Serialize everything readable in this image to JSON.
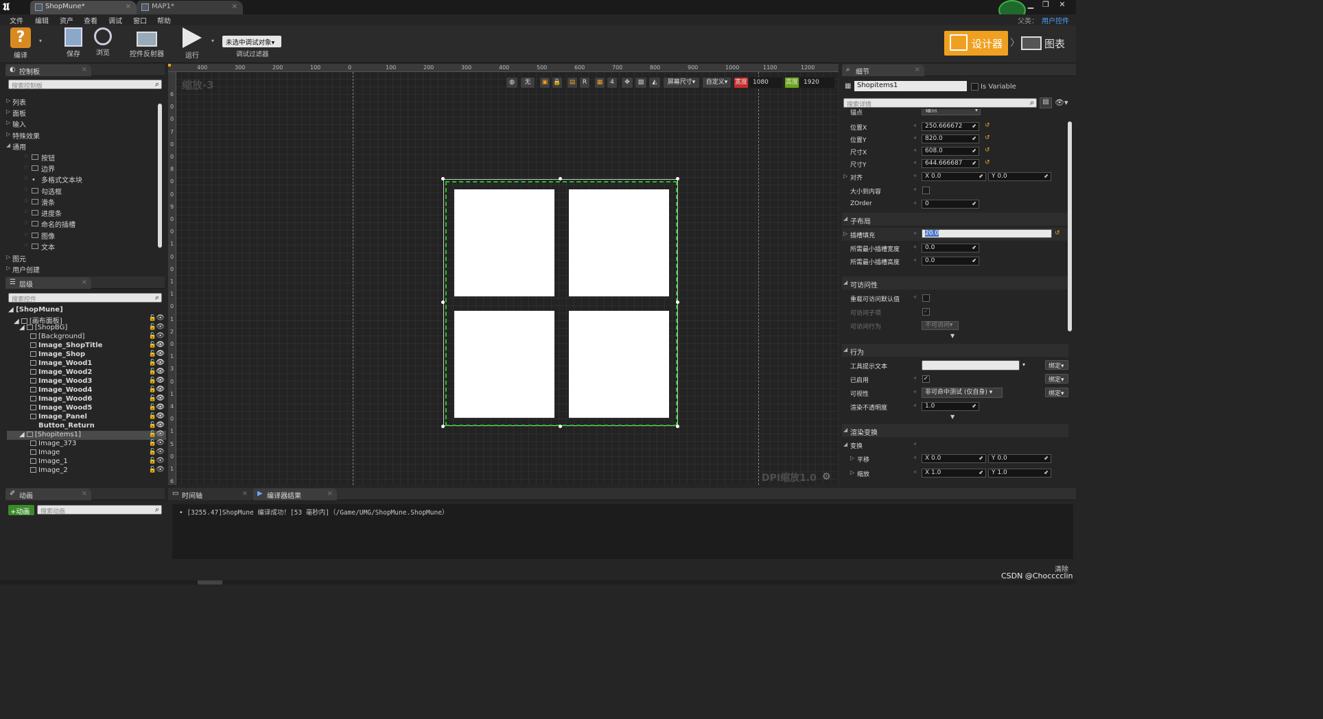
{
  "window": {
    "tabs": [
      "ShopMune*",
      "MAP1*"
    ],
    "user": "父类：",
    "user_link": "用户控件",
    "controls": [
      "▁",
      "❐",
      "✕"
    ]
  },
  "menu": [
    "文件",
    "编辑",
    "资产",
    "查看",
    "调试",
    "窗口",
    "帮助"
  ],
  "toolbar": {
    "compile": "编译",
    "save": "保存",
    "browse": "浏览",
    "reflector": "控件反射器",
    "run": "运行",
    "debug_select": "未选中调试对象▾",
    "debug_filter": "调试过滤器",
    "designer": "设计器",
    "graph": "图表"
  },
  "palette": {
    "title": "控制板",
    "search_placeholder": "搜索控制板",
    "categories": [
      "列表",
      "面板",
      "输入",
      "特殊效果",
      "通用"
    ],
    "common_items": [
      "按钮",
      "边界",
      "多格式文本块",
      "勾选框",
      "滑条",
      "进度条",
      "命名的插槽",
      "图像",
      "文本"
    ],
    "categories_after": [
      "图元",
      "用户创建"
    ]
  },
  "hierarchy": {
    "title": "层级",
    "search_placeholder": "搜索控件",
    "rows": [
      "[ShopMune]",
      "[画布面板]",
      "[ShopBG]",
      "[Background]",
      "Image_ShopTitle",
      "Image_Shop",
      "Image_Wood1",
      "Image_Wood2",
      "Image_Wood3",
      "Image_Wood4",
      "Image_Wood6",
      "Image_Wood5",
      "Image_Panel",
      "Button_Return",
      "[Shopitems1]",
      "Image_373",
      "Image",
      "Image_1",
      "Image_2"
    ]
  },
  "designer": {
    "zoom": "缩放-3",
    "dpi": "DPI缩放1.0",
    "none_btn": "无",
    "r_btn": "R",
    "four_btn": "4",
    "screen_size": "屏幕尺寸▾",
    "custom": "自定义▾",
    "width_label": "宽度",
    "width_val": "1080",
    "height_label": "高度",
    "height_val": "1920",
    "ruler_h": [
      "400",
      "300",
      "200",
      "100",
      "0",
      "100",
      "200",
      "300",
      "400",
      "500",
      "600",
      "700",
      "800",
      "900",
      "1000",
      "1100",
      "1200"
    ],
    "ruler_v": [
      "6",
      "0",
      "0",
      "7",
      "0",
      "0",
      "8",
      "0",
      "0",
      "9",
      "0",
      "0",
      "1",
      "0",
      "0",
      "1",
      "1",
      "0",
      "1",
      "2",
      "0",
      "1",
      "3",
      "0",
      "1",
      "4",
      "0",
      "1",
      "5",
      "0",
      "1",
      "6",
      "0"
    ]
  },
  "details": {
    "title": "细节",
    "name": "Shopitems1",
    "is_variable": "Is Variable",
    "search_placeholder": "搜索详情",
    "anchor_label": "锚点",
    "anchor_val": "锚点",
    "pos_x_label": "位置X",
    "pos_x": "250.666672",
    "pos_y_label": "位置Y",
    "pos_y": "820.0",
    "size_x_label": "尺寸X",
    "size_x": "608.0",
    "size_y_label": "尺寸Y",
    "size_y": "644.666687",
    "align_label": "对齐",
    "align_x": "X  0.0",
    "align_y": "Y  0.0",
    "size_to_content": "大小到内容",
    "zorder_label": "ZOrder",
    "zorder": "0",
    "sec_layout": "子布局",
    "slot_padding": "插槽填充",
    "slot_padding_val": "20.0",
    "min_w": "所需最小插槽宽度",
    "min_w_val": "0.0",
    "min_h": "所需最小插槽高度",
    "min_h_val": "0.0",
    "sec_access": "可访问性",
    "override_access": "重载可访问默认值",
    "access_children": "可访问子项",
    "access_behavior": "可访问行为",
    "access_behavior_val": "不可访问▾",
    "sec_behavior": "行为",
    "tooltip": "工具提示文本",
    "enabled": "已启用",
    "visibility": "可视性",
    "visibility_val": "非可命中测试 (仅自身) ▾",
    "opacity": "渲染不透明度",
    "opacity_val": "1.0",
    "bind": "绑定▾",
    "sec_render": "渲染变换",
    "transform": "变换",
    "translate": "平移",
    "translate_x": "X  0.0",
    "translate_y": "Y  0.0",
    "scale": "缩放",
    "scale_x": "X  1.0",
    "scale_y": "Y  1.0"
  },
  "animation": {
    "title": "动画",
    "add": "+动画",
    "search_placeholder": "搜索动画"
  },
  "bottom": {
    "tab_timeline": "时间轴",
    "tab_compiler": "编译器结果",
    "log": "•   [3255.47]ShopMune 编译成功！[53 毫秒内]（/Game/UMG/ShopMune.ShopMune）",
    "clear": "清除"
  },
  "watermark": "CSDN @Chocccclin",
  "colors": {
    "accent": "#f0a020",
    "selection": "#22c422",
    "active_tab": "#4a4a4a"
  }
}
